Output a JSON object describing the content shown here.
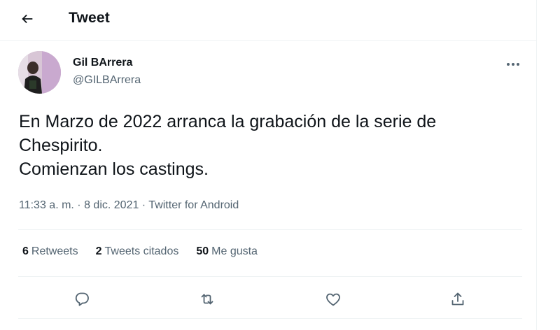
{
  "header": {
    "title": "Tweet",
    "back_icon": "arrow-left-icon"
  },
  "author": {
    "display_name": "Gil BArrera",
    "handle": "@GILBArrera"
  },
  "tweet": {
    "text": "En Marzo de 2022 arranca la grabación de la serie de\nChespirito.\nComienzan los castings.",
    "time": "11:33 a. m.",
    "separator": " · ",
    "date": "8 dic. 2021",
    "source": "Twitter for Android"
  },
  "stats": {
    "retweets_count": "6",
    "retweets_label": "Retweets",
    "quotes_count": "2",
    "quotes_label": "Tweets citados",
    "likes_count": "50",
    "likes_label": "Me gusta"
  },
  "actions": [
    "reply-icon",
    "retweet-icon",
    "like-icon",
    "share-icon"
  ],
  "colors": {
    "text": "#0f1419",
    "secondary": "#536471",
    "divider": "#eff3f4"
  }
}
